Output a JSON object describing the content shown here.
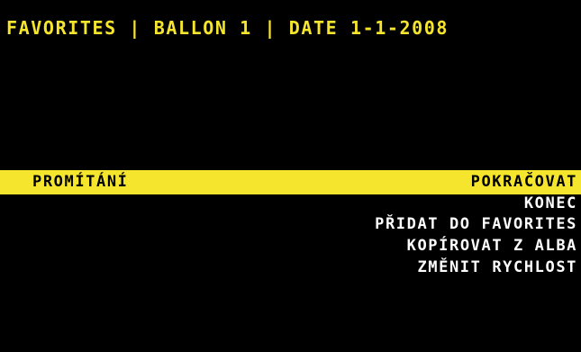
{
  "header": {
    "title": "FAVORITES | BALLON 1 | DATE 1-1-2008"
  },
  "section": {
    "label": "PROMÍTÁNÍ"
  },
  "menu": {
    "items": [
      {
        "label": "POKRAČOVAT",
        "selected": true
      },
      {
        "label": "KONEC",
        "selected": false
      },
      {
        "label": "PŘIDAT DO FAVORITES",
        "selected": false
      },
      {
        "label": "KOPÍROVAT Z ALBA",
        "selected": false
      },
      {
        "label": "ZMĚNIT RYCHLOST",
        "selected": false
      }
    ]
  },
  "colors": {
    "accent": "#f5e52c",
    "background": "#000000",
    "text": "#ffffff"
  }
}
